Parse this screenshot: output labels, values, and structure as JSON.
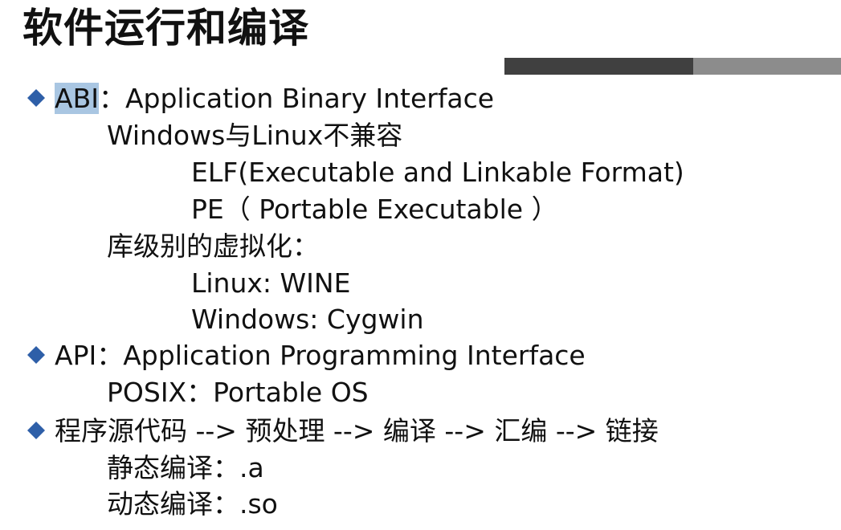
{
  "title": "软件运行和编译",
  "colors": {
    "bar_dark": "#404040",
    "bar_light": "#8c8c8c",
    "bullet": "#2e5fa8",
    "highlight": "#a9c6e2"
  },
  "items": [
    {
      "key": "ABI",
      "rest": "：Application Binary Interface",
      "sub": [
        {
          "text": "Windows与Linux不兼容",
          "sub": [
            "ELF(Executable and Linkable Format)",
            "PE（ Portable Executable ）"
          ]
        },
        {
          "text": "库级别的虚拟化：",
          "sub": [
            "Linux: WINE",
            "Windows: Cygwin"
          ]
        }
      ]
    },
    {
      "key": "API",
      "rest": "：Application Programming Interface",
      "sub": [
        {
          "text": "POSIX：Portable OS"
        }
      ]
    },
    {
      "key": "程序源代码 --> 预处理 --> 编译 --> 汇编 --> 链接",
      "rest": "",
      "sub": [
        {
          "text": "静态编译：.a"
        },
        {
          "text": "动态编译：.so"
        }
      ]
    }
  ]
}
